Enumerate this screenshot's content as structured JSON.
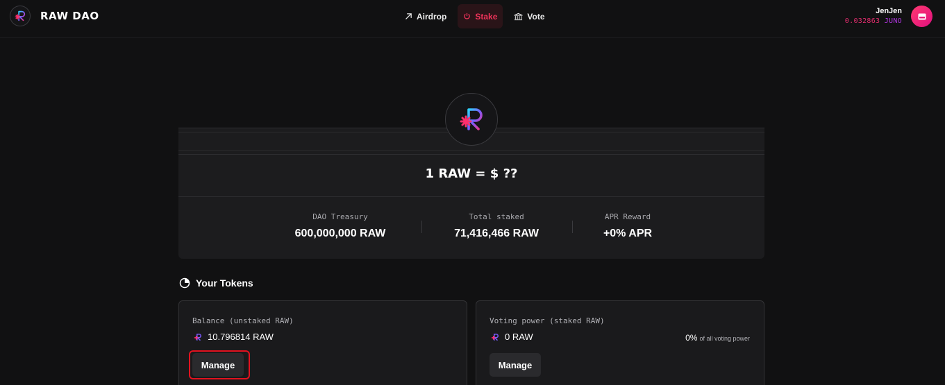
{
  "header": {
    "brand": "RAW DAO",
    "nav": [
      {
        "label": "Airdrop",
        "icon": "arrow-up-right-icon",
        "active": false
      },
      {
        "label": "Stake",
        "icon": "power-icon",
        "active": true
      },
      {
        "label": "Vote",
        "icon": "bank-icon",
        "active": false
      }
    ],
    "user": {
      "name": "JenJen",
      "balance": "0.032863",
      "unit": "JUNO"
    }
  },
  "stats": {
    "price": "1 RAW = $ ??",
    "treasury_label": "DAO Treasury",
    "treasury_value": "600,000,000 RAW",
    "staked_label": "Total staked",
    "staked_value": "71,416,466 RAW",
    "apr_label": "APR Reward",
    "apr_value": "+0% APR"
  },
  "tokens": {
    "title": "Your Tokens",
    "balance": {
      "label": "Balance (unstaked RAW)",
      "amount": "10.796814 RAW",
      "button": "Manage"
    },
    "voting": {
      "label": "Voting power (staked RAW)",
      "amount": "0 RAW",
      "percent": "0%",
      "percent_suffix": "of all voting power",
      "button": "Manage"
    }
  },
  "colors": {
    "accent": "#f0335a",
    "brand_pink": "#e22d6e",
    "brand_purple": "#b437e6",
    "highlight": "#e3121f"
  }
}
